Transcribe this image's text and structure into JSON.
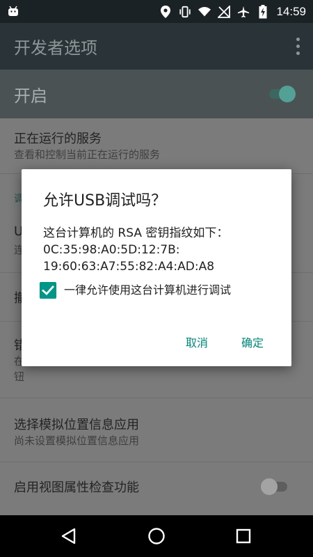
{
  "status_bar": {
    "time": "14:59",
    "icons": [
      "android-icon",
      "location-icon",
      "vibrate-icon",
      "wifi-icon",
      "no-signal-icon",
      "airplane-mode-icon",
      "battery-charging-icon"
    ]
  },
  "app_bar": {
    "title": "开发者选项",
    "overflow_icon": "more-vert-icon"
  },
  "master_switch": {
    "label": "开启",
    "on": true
  },
  "settings": {
    "running_services": {
      "title": "正在运行的服务",
      "summary": "查看和控制当前正在运行的服务"
    },
    "debug_category": "调",
    "usb_debugging": {
      "title": "U",
      "summary": "连"
    },
    "revoke": {
      "title": "撤"
    },
    "bug_report": {
      "title": "错",
      "summary_1": "在",
      "summary_2": "钮"
    },
    "mock_location": {
      "title": "选择模拟位置信息应用",
      "summary": "尚未设置模拟位置信息应用"
    },
    "view_attr": {
      "title": "启用视图属性检查功能",
      "on": false
    }
  },
  "dialog": {
    "title": "允许USB调试吗？",
    "message_line1": "这台计算机的 RSA 密钥指纹如下：",
    "message_line2": "0C:35:98:A0:5D:12:7B:",
    "message_line3": "19:60:63:A7:55:82:A4:AD:A8",
    "checkbox_label": "一律允许使用这台计算机进行调试",
    "checkbox_checked": true,
    "cancel_label": "取消",
    "ok_label": "确定",
    "accent_color": "#009688"
  },
  "nav_bar": {
    "icons": [
      "back-icon",
      "home-icon",
      "recents-icon"
    ]
  }
}
